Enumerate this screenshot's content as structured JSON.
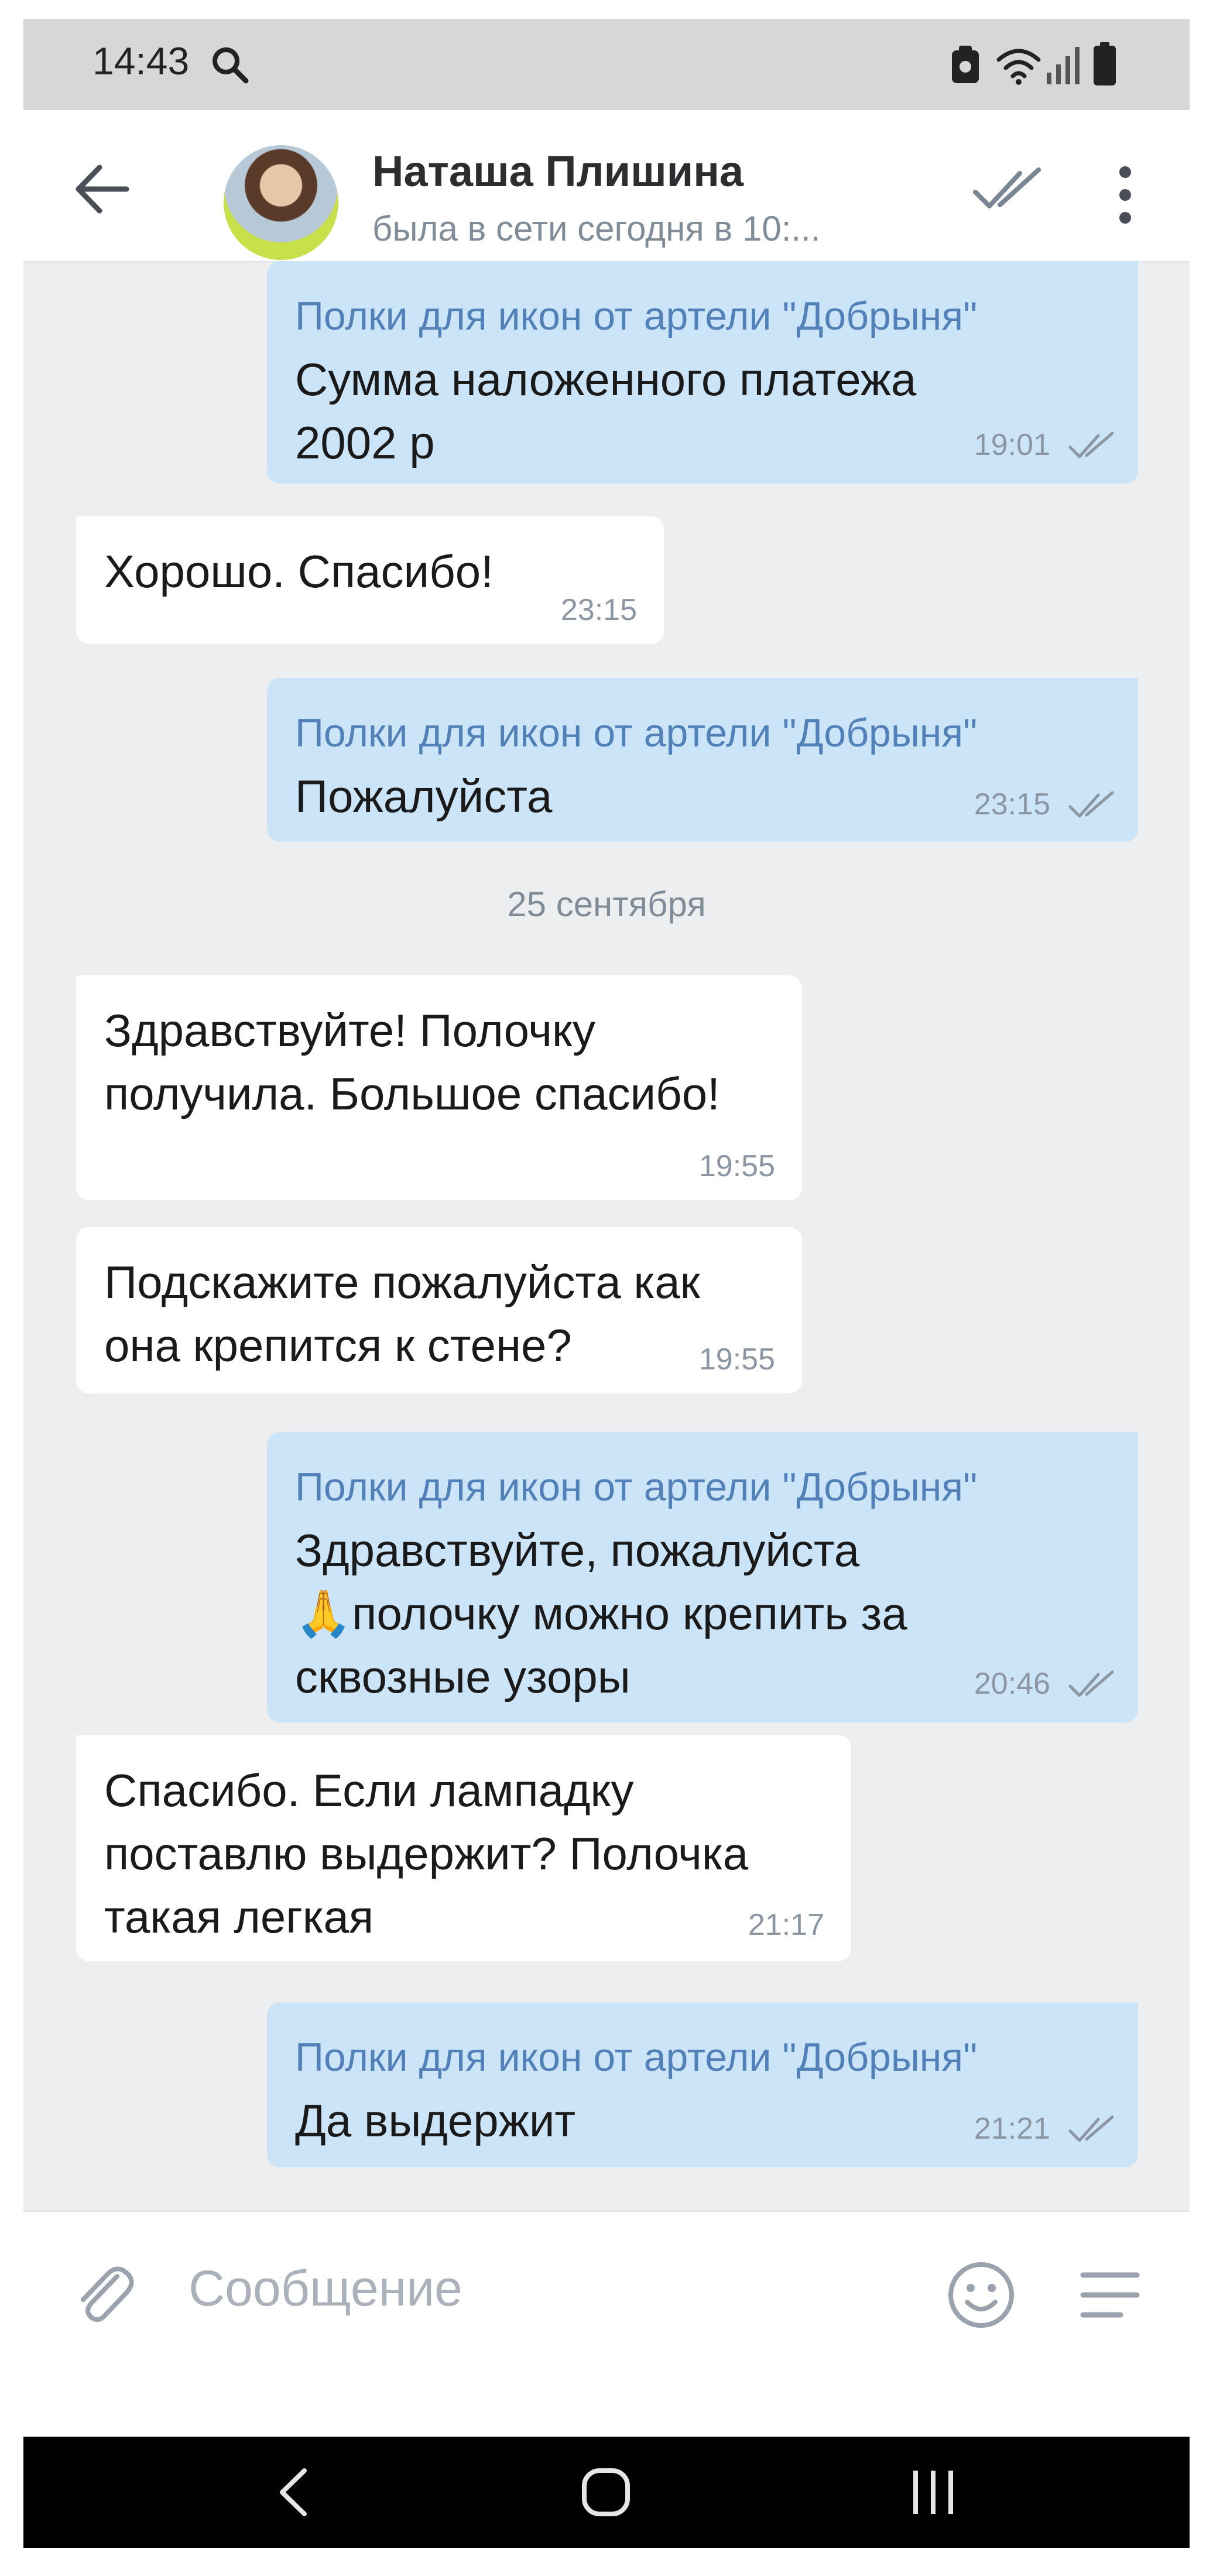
{
  "status_bar": {
    "time": "14:43",
    "icons": [
      "search-icon",
      "screenshot-icon",
      "wifi-icon",
      "signal-icon",
      "battery-icon"
    ]
  },
  "header": {
    "contact_name": "Наташа Плишина",
    "presence": "была в сети сегодня в 10:...",
    "icons": [
      "back-arrow-icon",
      "avatar",
      "double-check-icon",
      "more-vertical-icon"
    ]
  },
  "chat": {
    "messages": [
      {
        "direction": "outgoing",
        "sender": "Полки для икон от артели \"Добрыня\"",
        "text": "Сумма наложенного платежа\n2002 р",
        "time": "19:01",
        "read": true
      },
      {
        "direction": "incoming",
        "text": "Хорошо. Спасибо!",
        "time": "23:15"
      },
      {
        "direction": "outgoing",
        "sender": "Полки для икон от артели \"Добрыня\"",
        "text": "Пожалуйста",
        "time": "23:15",
        "read": true
      },
      {
        "direction": "incoming",
        "text": "Здравствуйте! Полочку\nполучила. Большое спасибо!",
        "time": "19:55"
      },
      {
        "direction": "incoming",
        "text": "Подскажите пожалуйста как\nона крепится к стене?",
        "time": "19:55"
      },
      {
        "direction": "outgoing",
        "sender": "Полки для икон от артели \"Добрыня\"",
        "text": "Здравствуйте, пожалуйста\n🙏полочку можно крепить за\nсквозные узоры",
        "time": "20:46",
        "read": true
      },
      {
        "direction": "incoming",
        "text": "Спасибо. Если лампадку\nпоставлю выдержит? Полочка\nтакая легкая",
        "time": "21:17"
      },
      {
        "direction": "outgoing",
        "sender": "Полки для икон от артели \"Добрыня\"",
        "text": "Да выдержит",
        "time": "21:21",
        "read": true
      }
    ],
    "date_separator": "25 сентября"
  },
  "input_bar": {
    "placeholder": "Сообщение",
    "icons": [
      "attach-icon",
      "smile-icon",
      "menu-icon"
    ]
  },
  "nav_bar": {
    "icons": [
      "nav-back-icon",
      "nav-home-icon",
      "nav-recents-icon"
    ]
  },
  "colors": {
    "outgoing_bubble": "#cce4f7",
    "incoming_bubble": "#ffffff",
    "chat_background": "#edeef0",
    "sender_name": "#5181b8",
    "meta_text": "#818c99"
  }
}
